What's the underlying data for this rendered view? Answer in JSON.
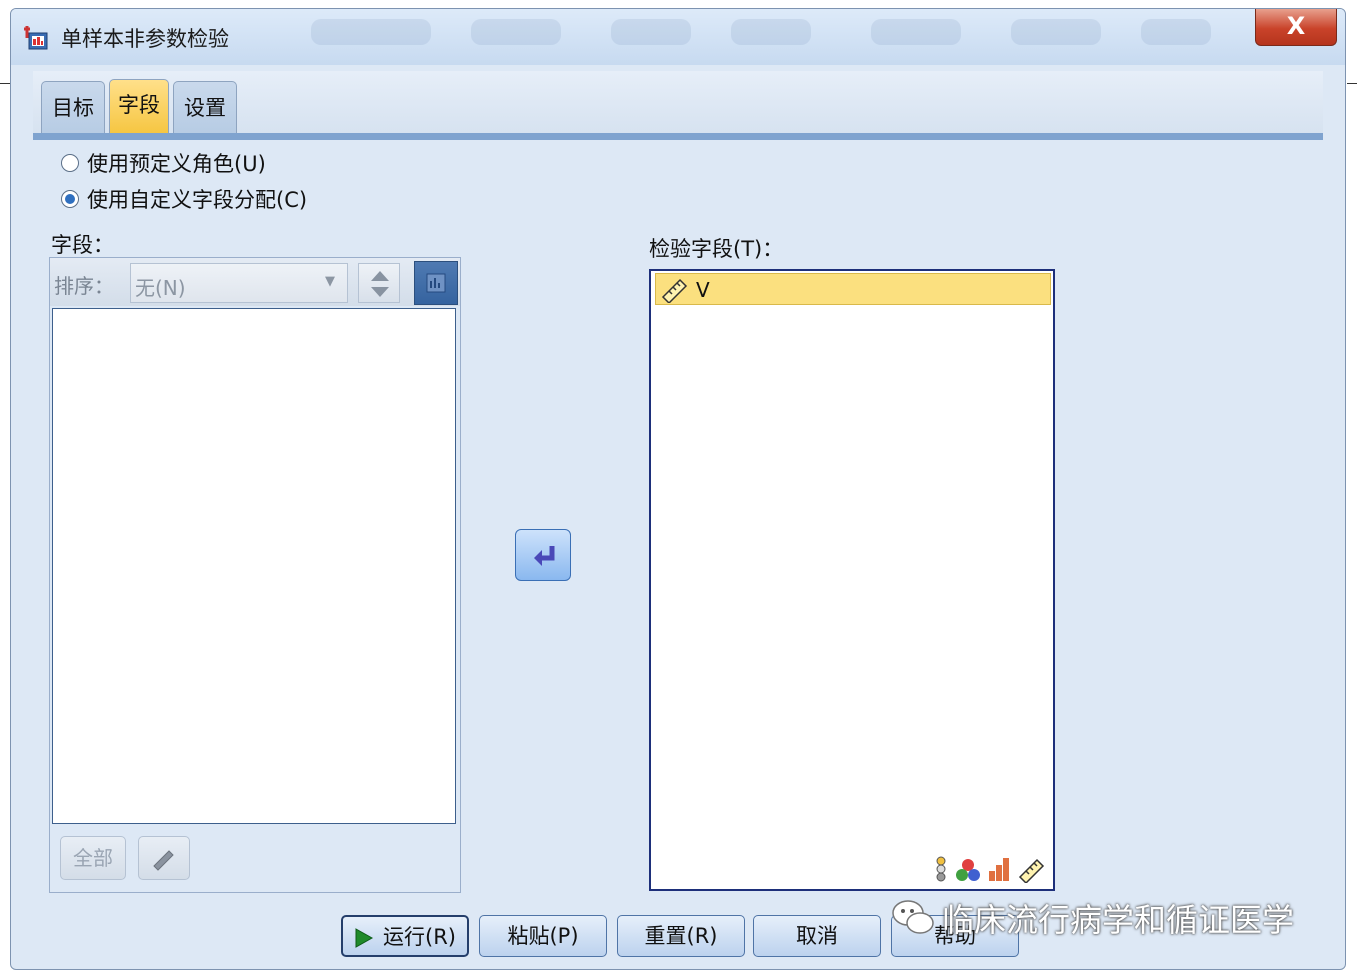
{
  "window": {
    "title": "单样本非参数检验",
    "close_label": "X"
  },
  "tabs": [
    {
      "label": "目标",
      "active": false
    },
    {
      "label": "字段",
      "active": true
    },
    {
      "label": "设置",
      "active": false
    }
  ],
  "role_options": {
    "predefined": {
      "label": "使用预定义角色(U)",
      "checked": false
    },
    "custom": {
      "label": "使用自定义字段分配(C)",
      "checked": true
    }
  },
  "fields_panel": {
    "label": "字段：",
    "sort_label": "排序：",
    "sort_value": "无(N)",
    "all_button": "全部",
    "items": []
  },
  "test_fields": {
    "label": "检验字段(T)：",
    "items": [
      {
        "name": "V",
        "icon": "scale-ruler-icon"
      }
    ]
  },
  "footer": {
    "run": "运行(R)",
    "paste": "粘贴(P)",
    "reset": "重置(R)",
    "cancel": "取消",
    "help": "帮助"
  },
  "watermark": "临床流行病学和循证医学",
  "colors": {
    "active_tab": "#f6c642",
    "selected_item": "#fbe07f",
    "close_button": "#c9432a",
    "dialog_bg": "#dde8f5"
  }
}
